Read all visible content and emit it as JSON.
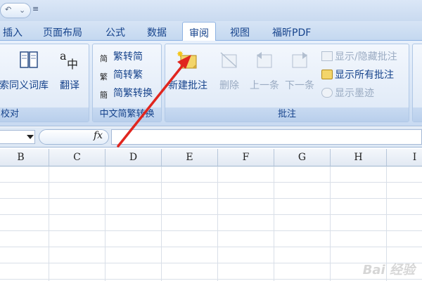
{
  "tabs": [
    "插入",
    "页面布局",
    "公式",
    "数据",
    "审阅",
    "视图",
    "福昕PDF"
  ],
  "active_tab": "审阅",
  "ribbon": {
    "proofing": {
      "research_label": "索",
      "thesaurus_label": "同义词库",
      "translate_label": "翻译",
      "group_label": "校对"
    },
    "chinese_conversion": {
      "to_simplified": "繁转简",
      "to_traditional": "简转繁",
      "conversion": "简繁转换",
      "group_label": "中文简繁转换"
    },
    "comments": {
      "new_comment": "新建批注",
      "delete": "删除",
      "previous": "上一条",
      "next": "下一条",
      "show_hide": "显示/隐藏批注",
      "show_all": "显示所有批注",
      "show_ink": "显示墨迹",
      "group_label": "批注"
    }
  },
  "formula_bar": {
    "fx_label": "fx"
  },
  "columns": [
    "B",
    "C",
    "D",
    "E",
    "F",
    "G",
    "H",
    "I"
  ],
  "watermark": "Bai 经验",
  "colors": {
    "accent": "#15428b",
    "arrow": "#e0261f",
    "ribbon_bg": "#dde8f6"
  }
}
